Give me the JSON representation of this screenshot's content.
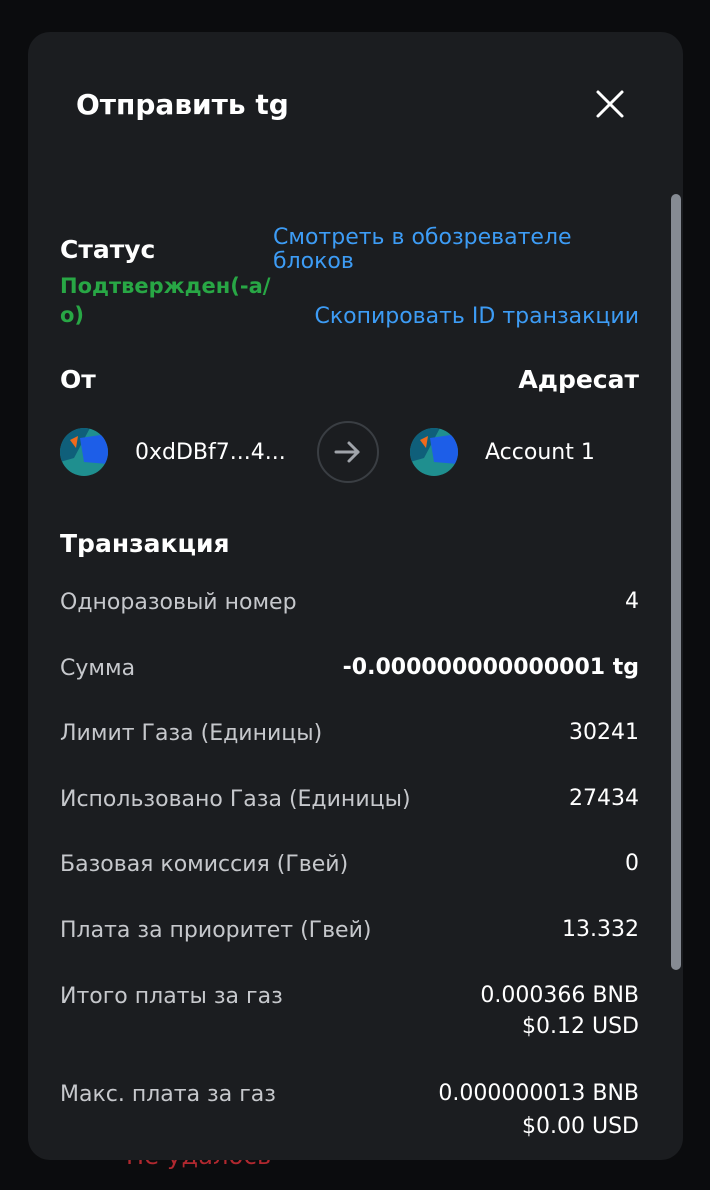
{
  "background": {
    "status_fail": "Не удалось"
  },
  "modal": {
    "title": "Отправить tg",
    "status": {
      "label": "Статус",
      "value": "Подтвержден(-а/о)",
      "value_color": "#28a745"
    },
    "links": {
      "explorer": "Смотреть в обозревателе блоков",
      "copy_tx_id": "Скопировать ID транзакции"
    },
    "from_to": {
      "from_label": "От",
      "to_label": "Адресат",
      "from_address": "0xdDBf7...4...",
      "to_account": "Account 1"
    },
    "transaction": {
      "title": "Транзакция",
      "rows": [
        {
          "label": "Одноразовый номер",
          "value": "4"
        },
        {
          "label": "Сумма",
          "value": "-0.000000000000001 tg"
        },
        {
          "label": "Лимит Газа (Единицы)",
          "value": "30241"
        },
        {
          "label": "Использовано Газа (Единицы)",
          "value": "27434"
        },
        {
          "label": "Базовая комиссия (Гвей)",
          "value": "0"
        },
        {
          "label": "Плата за приоритет (Гвей)",
          "value": "13.332"
        },
        {
          "label": "Итого платы за газ",
          "value": "0.000366 BNB",
          "value2": "$0.12 USD"
        },
        {
          "label": "Макс. плата за газ",
          "value": "0.000000013 BNB",
          "value2": "$0.00 USD"
        }
      ]
    }
  },
  "colors": {
    "accent_link": "#3d9cf5",
    "success": "#28a745",
    "fail": "#b0282f"
  },
  "icons": {
    "close": "close-icon",
    "arrow": "arrow-right-icon",
    "avatar": "jazzicon-avatar"
  }
}
